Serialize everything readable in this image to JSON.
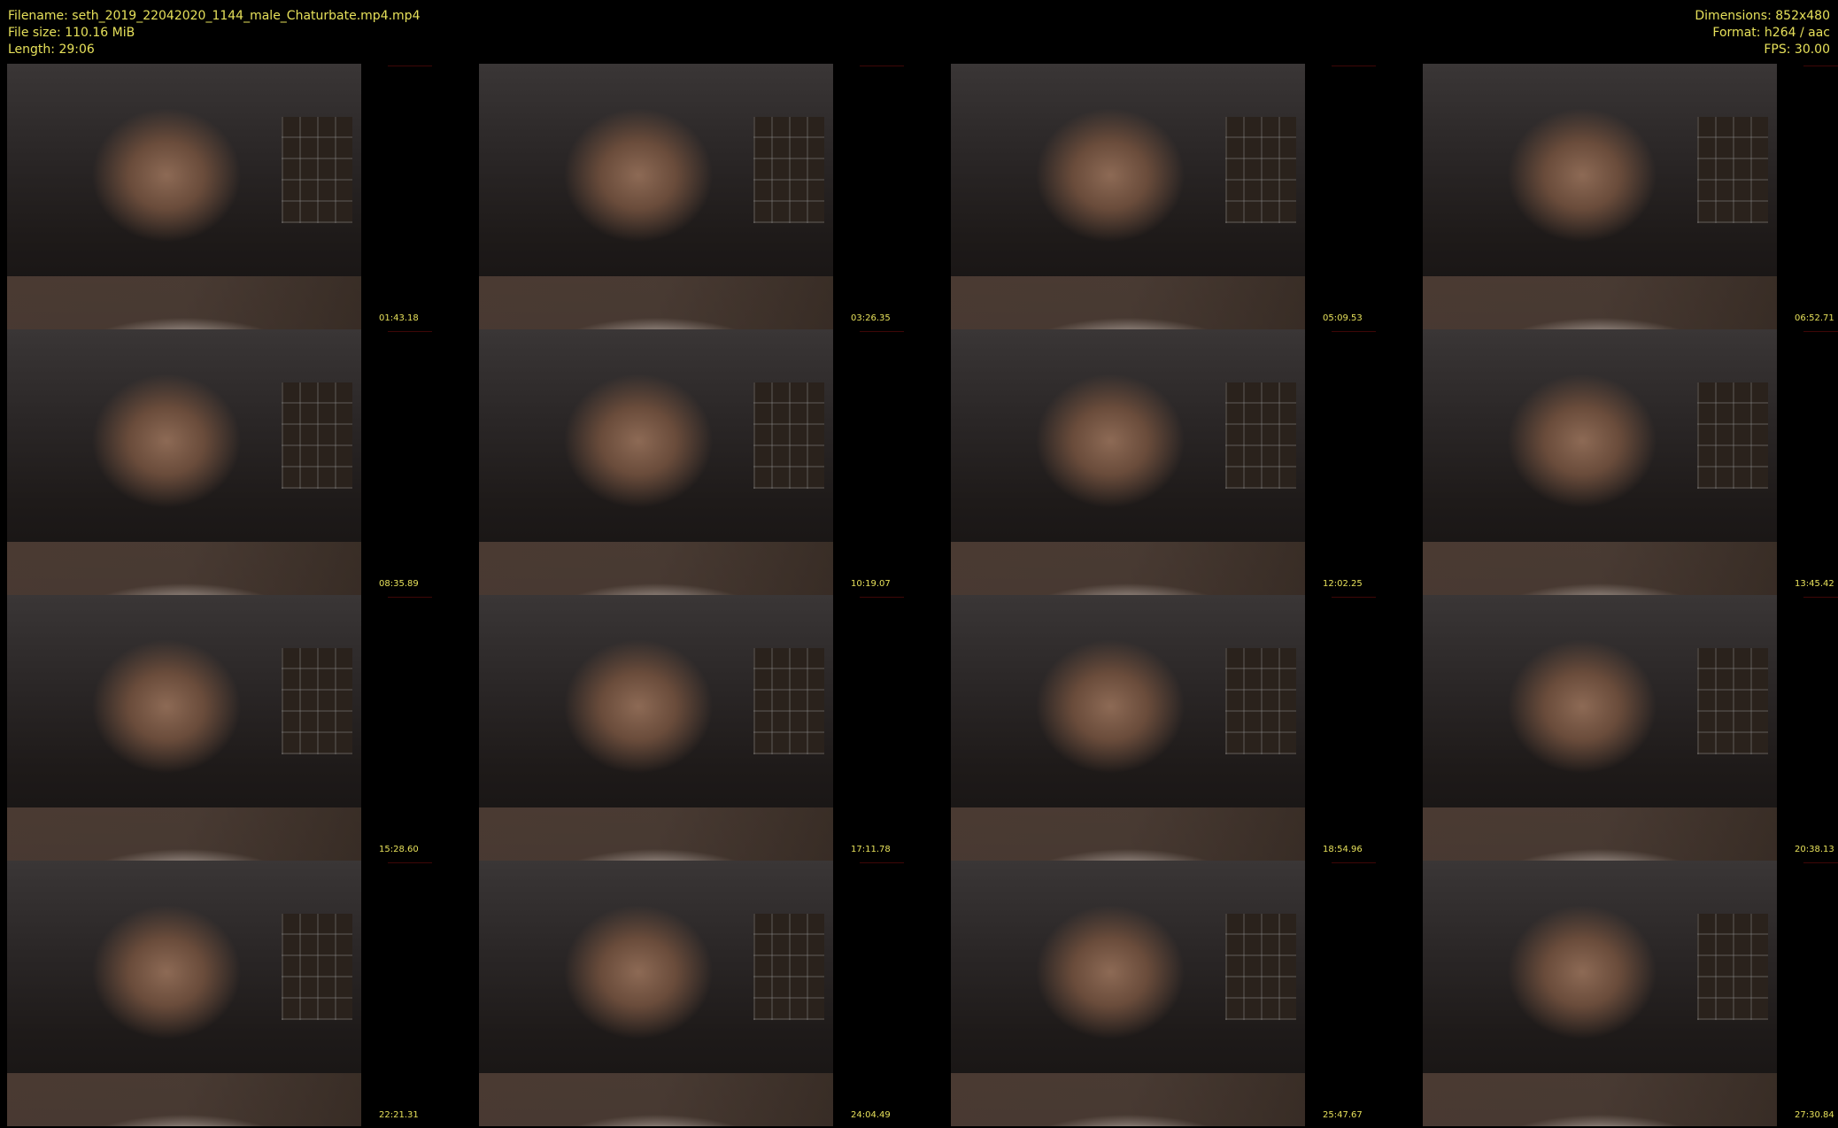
{
  "header": {
    "filename": "Filename: seth_2019_22042020_1144_male_Chaturbate.mp4.mp4",
    "filesize": "File size: 110.16 MiB",
    "length": "Length: 29:06",
    "dimensions": "Dimensions: 852x480",
    "format": "Format: h264 / aac",
    "fps": "FPS: 30.00"
  },
  "thumbnails": [
    {
      "time": "01:43.18"
    },
    {
      "time": "03:26.35"
    },
    {
      "time": "05:09.53"
    },
    {
      "time": "06:52.71"
    },
    {
      "time": "08:35.89"
    },
    {
      "time": "10:19.07"
    },
    {
      "time": "12:02.25"
    },
    {
      "time": "13:45.42"
    },
    {
      "time": "15:28.60"
    },
    {
      "time": "17:11.78"
    },
    {
      "time": "18:54.96"
    },
    {
      "time": "20:38.13"
    },
    {
      "time": "22:21.31"
    },
    {
      "time": "24:04.49"
    },
    {
      "time": "25:47.67"
    },
    {
      "time": "27:30.84"
    }
  ]
}
